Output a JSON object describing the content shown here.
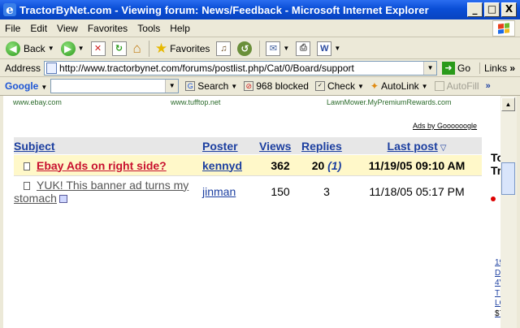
{
  "window": {
    "title": "TractorByNet.com - Viewing forum: News/Feedback - Microsoft Internet Explorer",
    "buttons": [
      "_",
      "□",
      "X"
    ]
  },
  "menu": [
    "File",
    "Edit",
    "View",
    "Favorites",
    "Tools",
    "Help"
  ],
  "toolbar": {
    "back": "Back",
    "favorites": "Favorites"
  },
  "address": {
    "label": "Address",
    "url": "http://www.tractorbynet.com/forums/postlist.php/Cat/0/Board/support",
    "go": "Go",
    "links": "Links"
  },
  "googlebar": {
    "logo": "Google",
    "search": "Search",
    "blocked": "968 blocked",
    "check": "Check",
    "autolink": "AutoLink",
    "autofill": "AutoFill"
  },
  "page": {
    "ad_links": [
      "www.ebay.com",
      "www.tufftop.net",
      "LawnMower.MyPremiumRewards.com"
    ],
    "ads_by": "Ads by Goooooogle",
    "table": {
      "headers": {
        "subject": "Subject",
        "poster": "Poster",
        "views": "Views",
        "replies": "Replies",
        "last_post": "Last post"
      },
      "rows": [
        {
          "subject": "Ebay Ads on right side?",
          "poster": "kennyd",
          "views": "362",
          "replies": "20",
          "replies_extra": "(1)",
          "last_post": "11/19/05 09:10 AM"
        },
        {
          "subject": "YUK! This banner ad turns my stomach",
          "poster": "jinman",
          "views": "150",
          "replies": "3",
          "last_post": "11/18/05 05:17 PM"
        }
      ]
    },
    "side_text": [
      "To",
      "Tr"
    ],
    "side_links": [
      "19",
      "DI",
      "4V",
      "TF",
      "LO"
    ],
    "side_price": "$7"
  }
}
